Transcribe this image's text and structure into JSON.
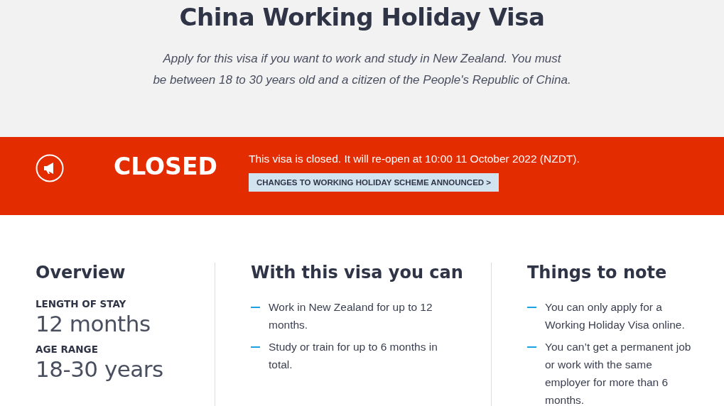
{
  "header": {
    "title": "China Working Holiday Visa",
    "description": [
      "Apply for this visa if you want to work and study in New Zealand. You must",
      "be between 18 to 30 years old and a citizen of the People's Republic of China."
    ]
  },
  "status_banner": {
    "status": "CLOSED",
    "message": "This visa is closed. It will re-open at 10:00 11 October 2022 (NZDT).",
    "link": "CHANGES TO WORKING HOLIDAY SCHEME ANNOUNCED >"
  },
  "overview": {
    "title": "Overview",
    "facts": [
      {
        "label": "LENGTH OF STAY",
        "value": "12 months"
      },
      {
        "label": "AGE RANGE",
        "value": "18-30 years"
      }
    ]
  },
  "can_do": {
    "title": "With this visa you can",
    "items": [
      "Work in New Zealand for up to 12 months.",
      "Study or train for up to 6 months in total."
    ]
  },
  "notes": {
    "title": "Things to note",
    "items": [
      "You can only apply for a Working Holiday Visa online.",
      "You can’t get a permanent job or work with the same employer for more than 6 months."
    ]
  }
}
